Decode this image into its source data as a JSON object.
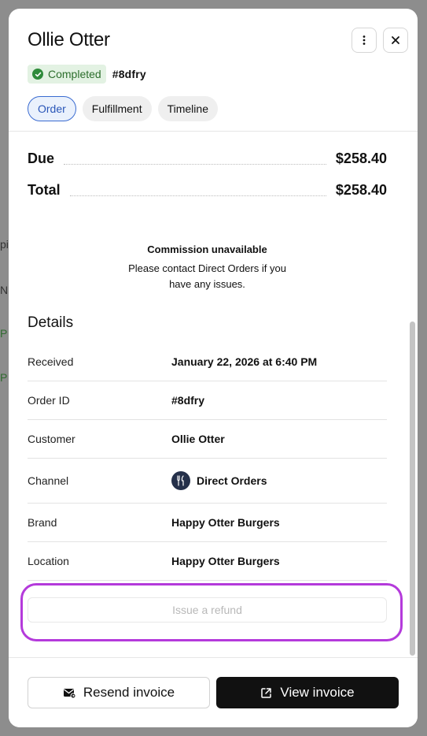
{
  "background": {
    "fragments": [
      "pie",
      "N",
      "P",
      "P"
    ]
  },
  "modal": {
    "title": "Ollie Otter",
    "status": "Completed",
    "order_ref": "#8dfry",
    "tabs": [
      {
        "label": "Order",
        "active": true
      },
      {
        "label": "Fulfillment",
        "active": false
      },
      {
        "label": "Timeline",
        "active": false
      }
    ],
    "icons": {
      "more": "more-vertical-icon",
      "close": "close-icon"
    }
  },
  "summary": {
    "due_label": "Due",
    "due_value": "$258.40",
    "total_label": "Total",
    "total_value": "$258.40"
  },
  "notice": {
    "title": "Commission unavailable",
    "line1": "Please contact Direct Orders if you",
    "line2": "have any issues."
  },
  "details": {
    "title": "Details",
    "rows": [
      {
        "key": "Received",
        "value": "January 22, 2026 at 6:40 PM"
      },
      {
        "key": "Order ID",
        "value": "#8dfry"
      },
      {
        "key": "Customer",
        "value": "Ollie Otter"
      },
      {
        "key": "Channel",
        "value": "Direct Orders"
      },
      {
        "key": "Brand",
        "value": "Happy Otter Burgers"
      },
      {
        "key": "Location",
        "value": "Happy Otter Burgers"
      }
    ]
  },
  "refund_label": "Issue a refund",
  "footer": {
    "resend_label": "Resend invoice",
    "view_label": "View invoice"
  },
  "colors": {
    "accent_blue": "#3a6bd1",
    "success_green": "#2e8b3a",
    "highlight_purple": "#b43adb",
    "primary_button": "#111111"
  }
}
